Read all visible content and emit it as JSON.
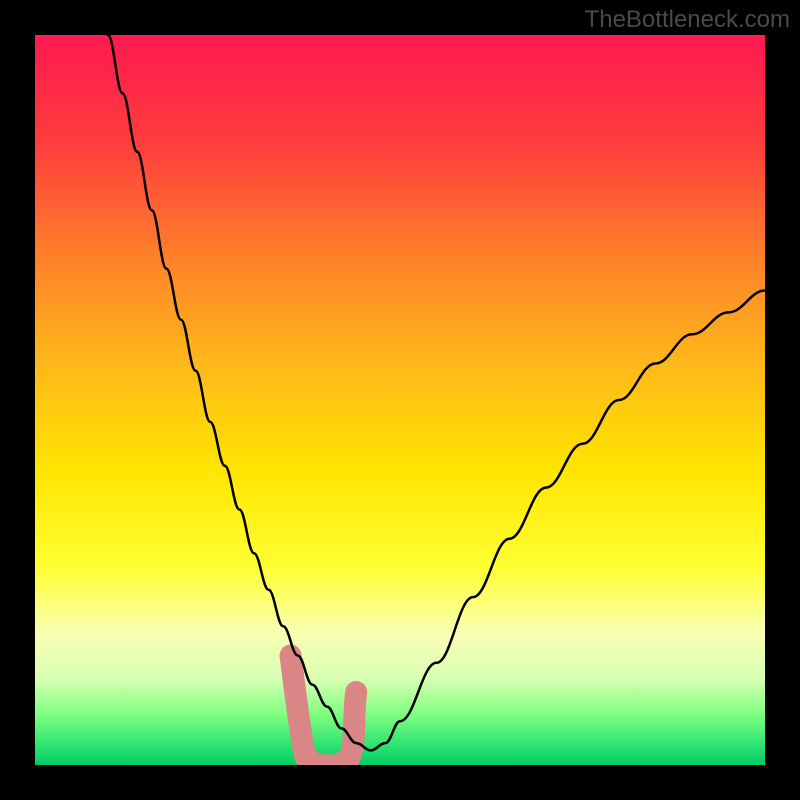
{
  "watermark": "TheBottleneck.com",
  "chart_data": {
    "type": "line",
    "title": "",
    "xlabel": "",
    "ylabel": "",
    "xlim": [
      0,
      100
    ],
    "ylim": [
      0,
      100
    ],
    "background": {
      "type": "vertical-gradient",
      "stops": [
        {
          "offset": 0.0,
          "color": "#ff1950"
        },
        {
          "offset": 0.15,
          "color": "#ff3d3d"
        },
        {
          "offset": 0.3,
          "color": "#ff7f2a"
        },
        {
          "offset": 0.45,
          "color": "#ffb81a"
        },
        {
          "offset": 0.6,
          "color": "#ffe600"
        },
        {
          "offset": 0.73,
          "color": "#ffff33"
        },
        {
          "offset": 0.82,
          "color": "#faffb3"
        },
        {
          "offset": 0.88,
          "color": "#d9ffb3"
        },
        {
          "offset": 0.93,
          "color": "#80ff80"
        },
        {
          "offset": 0.97,
          "color": "#33e673"
        },
        {
          "offset": 1.0,
          "color": "#00cc66"
        }
      ]
    },
    "series": [
      {
        "name": "bottleneck-curve",
        "color": "#000000",
        "x": [
          10,
          12,
          14,
          16,
          18,
          20,
          22,
          24,
          26,
          28,
          30,
          32,
          34,
          36,
          38,
          40,
          42,
          44,
          46,
          48,
          50,
          55,
          60,
          65,
          70,
          75,
          80,
          85,
          90,
          95,
          100
        ],
        "y": [
          100,
          92,
          84,
          76,
          68,
          61,
          54,
          47,
          41,
          35,
          29,
          24,
          19,
          15,
          11,
          8,
          5,
          3,
          2,
          3,
          6,
          14,
          23,
          31,
          38,
          44,
          50,
          55,
          59,
          62,
          65
        ]
      }
    ],
    "highlight": {
      "name": "pink-segment",
      "color": "#db8686",
      "x_range": [
        35,
        44
      ],
      "y_range": [
        0,
        15
      ]
    }
  }
}
